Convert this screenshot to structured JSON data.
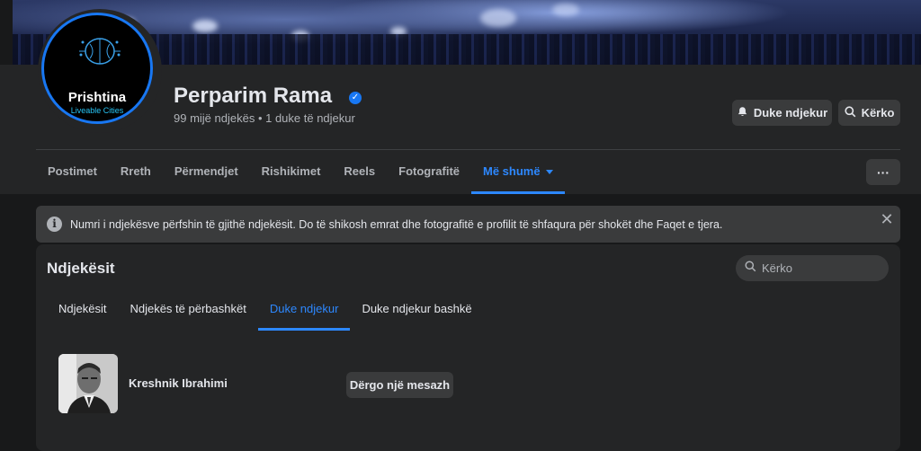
{
  "header": {
    "page_name": "Perparim Rama",
    "verified_icon": "verified-badge-icon",
    "followers_line": "99 mijë ndjekës • 1 duke të ndjekur",
    "avatar_logo_line1": "Prishtina",
    "avatar_logo_line2": "Liveable Cities",
    "following_button": "Duke ndjekur",
    "search_button": "Kërko",
    "more_button": "···"
  },
  "tabs": [
    {
      "label": "Postimet"
    },
    {
      "label": "Rreth"
    },
    {
      "label": "Përmendjet"
    },
    {
      "label": "Rishikimet"
    },
    {
      "label": "Reels"
    },
    {
      "label": "Fotografitë"
    },
    {
      "label": "Më shumë",
      "active": true
    }
  ],
  "notice": {
    "text": "Numri i ndjekësve përfshin të gjithë ndjekësit. Do të shikosh emrat dhe fotografitë e profilit të shfaqura për shokët dhe Faqet e tjera.",
    "close": "✕"
  },
  "followers_panel": {
    "title": "Ndjekësit",
    "search_placeholder": "Kërko",
    "subtabs": [
      {
        "label": "Ndjekësit"
      },
      {
        "label": "Ndjekës të përbashkët"
      },
      {
        "label": "Duke ndjekur",
        "active": true
      },
      {
        "label": "Duke ndjekur bashkë"
      }
    ],
    "people": [
      {
        "name": "Kreshnik Ibrahimi",
        "message_button": "Dërgo një mesazh"
      }
    ]
  },
  "colors": {
    "accent": "#2d88ff",
    "verified": "#1877f2",
    "bg": "#18191a",
    "card": "#242526"
  }
}
